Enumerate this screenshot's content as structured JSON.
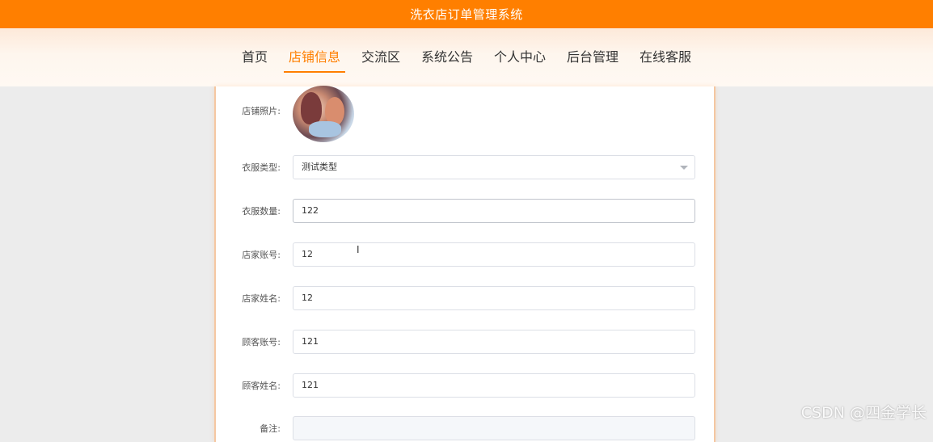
{
  "header": {
    "title": "洗衣店订单管理系统"
  },
  "nav": {
    "items": [
      {
        "label": "首页"
      },
      {
        "label": "店铺信息"
      },
      {
        "label": "交流区"
      },
      {
        "label": "系统公告"
      },
      {
        "label": "个人中心"
      },
      {
        "label": "后台管理"
      },
      {
        "label": "在线客服"
      }
    ],
    "active_index": 1
  },
  "form": {
    "photo_label": "店铺照片:",
    "clothing_type": {
      "label": "衣服类型:",
      "value": "测试类型"
    },
    "clothing_count": {
      "label": "衣服数量:",
      "value": "122"
    },
    "shop_account": {
      "label": "店家账号:",
      "value": "12"
    },
    "shop_name": {
      "label": "店家姓名:",
      "value": "12"
    },
    "customer_account": {
      "label": "顾客账号:",
      "value": "121"
    },
    "customer_name": {
      "label": "顾客姓名:",
      "value": "121"
    },
    "remark": {
      "label": "备注:"
    }
  },
  "watermark": "CSDN @四金学长",
  "colors": {
    "accent": "#ff7f00",
    "background": "#ececec"
  }
}
